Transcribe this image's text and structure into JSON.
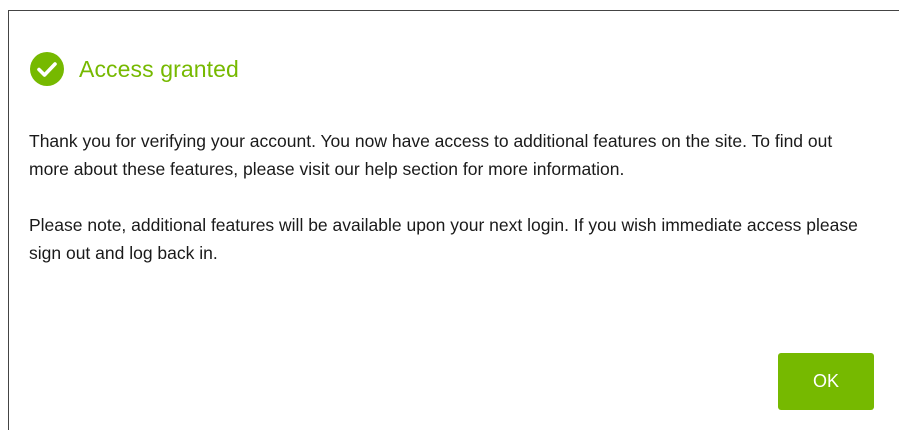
{
  "dialog": {
    "title": "Access granted",
    "icon": "check-circle-icon",
    "paragraphs": [
      "Thank you for verifying your account. You now have access to additional features on the site. To find out more about these features, please visit our help section for more information.",
      "Please note, additional features will be available upon your next login. If you wish immediate access please sign out and log back in."
    ],
    "ok_label": "OK"
  },
  "colors": {
    "accent": "#76b900",
    "text": "#1a1a1a",
    "border": "#444444"
  }
}
